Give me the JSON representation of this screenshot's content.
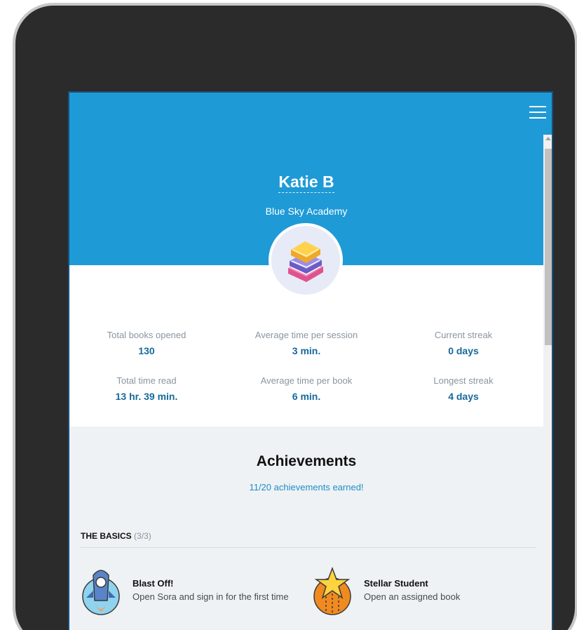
{
  "profile": {
    "name": "Katie B",
    "school": "Blue Sky Academy",
    "avatar_icon": "books-stack-icon"
  },
  "header": {
    "background": "#1e9ad6",
    "menu_icon": "hamburger-menu-icon"
  },
  "stats": [
    {
      "label": "Total books opened",
      "value": "130"
    },
    {
      "label": "Average time per session",
      "value": "3 min."
    },
    {
      "label": "Current streak",
      "value": "0 days"
    },
    {
      "label": "Total time read",
      "value": "13 hr. 39 min."
    },
    {
      "label": "Average time per book",
      "value": "6 min."
    },
    {
      "label": "Longest streak",
      "value": "4 days"
    }
  ],
  "achievements": {
    "title": "Achievements",
    "earned_text": "11/20 achievements earned!",
    "sections": [
      {
        "name": "THE BASICS",
        "count": "(3/3)",
        "items": [
          {
            "name": "Blast Off!",
            "description": "Open Sora and sign in for the first time",
            "icon": "rocket-badge-icon"
          },
          {
            "name": "Stellar Student",
            "description": "Open an assigned book",
            "icon": "star-badge-icon"
          }
        ]
      }
    ]
  },
  "colors": {
    "accent": "#1e9ad6",
    "stat_value": "#17699b",
    "link": "#1f8dc6"
  }
}
